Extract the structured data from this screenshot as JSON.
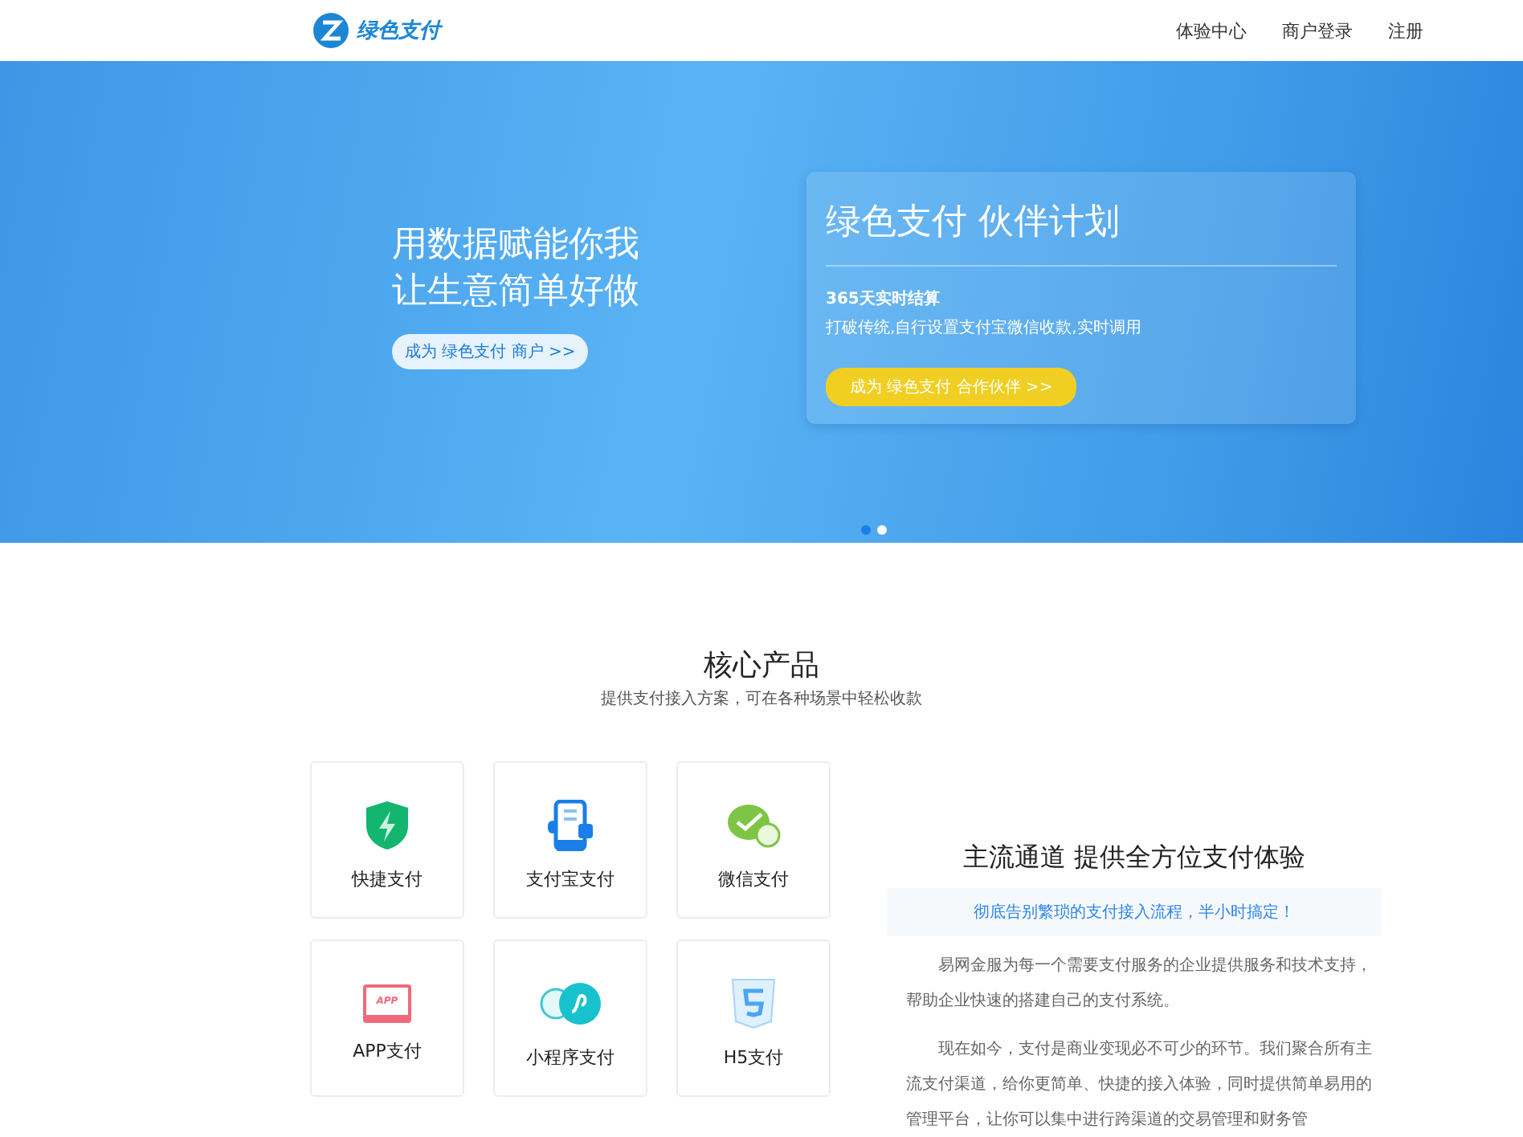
{
  "header": {
    "logo_text": "绿色支付",
    "nav": [
      {
        "label": "体验中心"
      },
      {
        "label": "商户登录"
      },
      {
        "label": "注册"
      }
    ]
  },
  "banner": {
    "headline": [
      "用数据赋能你我",
      "让生意简单好做"
    ],
    "merchant_button": "成为 绿色支付 商户 >>",
    "card": {
      "title": "绿色支付 伙伴计划",
      "subtitle": "365天实时结算",
      "description": "打破传统,自行设置支付宝微信收款,实时调用",
      "button": "成为 绿色支付 合作伙伴 >>"
    },
    "dots": [
      {
        "selected": true
      },
      {
        "selected": false
      }
    ]
  },
  "products": {
    "title": "核心产品",
    "subtitle": "提供支付接入方案，可在各种场景中轻松收款",
    "items": [
      {
        "kind": "shield",
        "label": "快捷支付"
      },
      {
        "kind": "phone",
        "label": "支付宝支付"
      },
      {
        "kind": "chat",
        "label": "微信支付"
      },
      {
        "kind": "app",
        "label": "APP支付",
        "icon_text": "APP"
      },
      {
        "kind": "mini",
        "label": "小程序支付"
      },
      {
        "kind": "h5",
        "label": "H5支付"
      }
    ]
  },
  "channels": {
    "title": "主流通道 提供全方位支付体验",
    "highlight": "彻底告别繁琐的支付接入流程，半小时搞定！",
    "paragraphs": [
      "易网金服为每一个需要支付服务的企业提供服务和技术支持，帮助企业快速的搭建自己的支付系统。",
      "现在如今，支付是商业变现必不可少的环节。我们聚合所有主流支付渠道，给你更简单、快捷的接入体验，同时提供简单易用的管理平台，让你可以集中进行跨渠道的交易管理和财务管"
    ]
  }
}
